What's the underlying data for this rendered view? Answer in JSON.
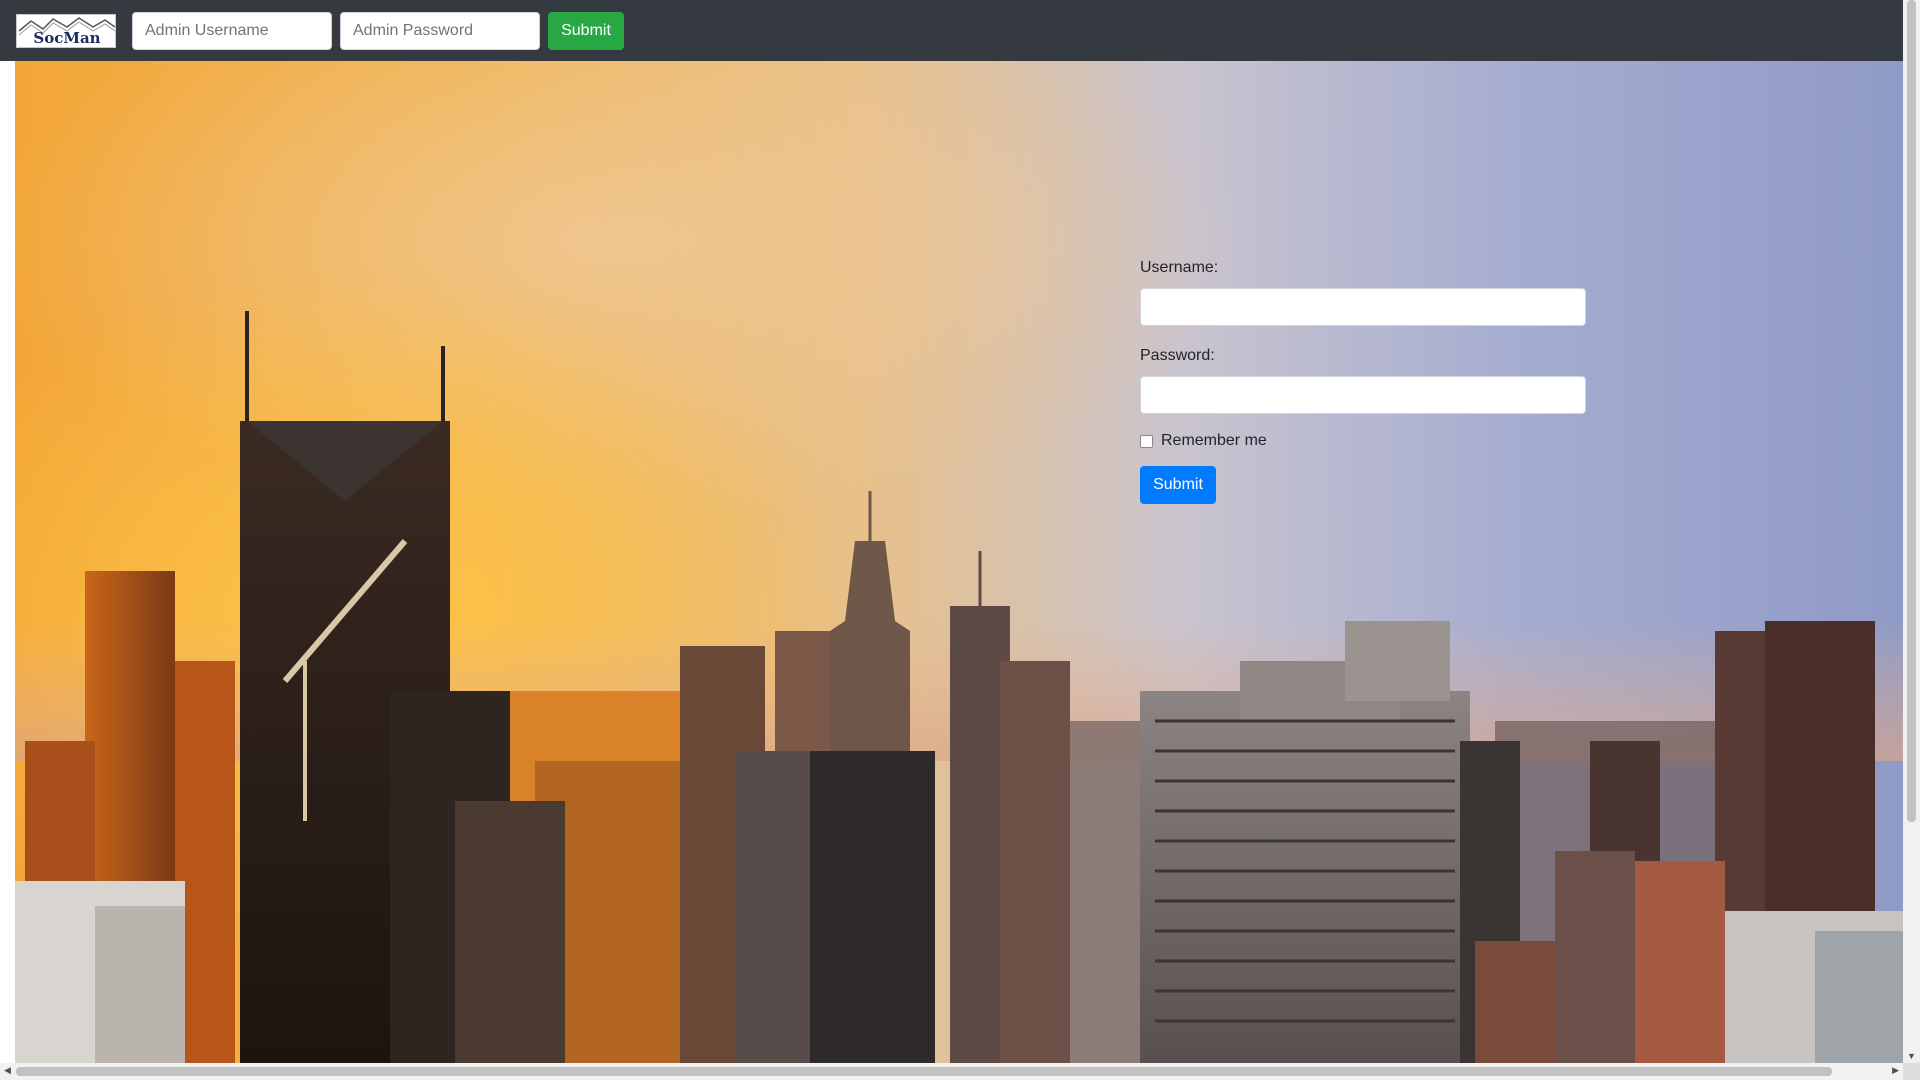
{
  "navbar": {
    "logo_text": "SocMan",
    "admin_username_placeholder": "Admin Username",
    "admin_password_placeholder": "Admin Password",
    "submit_label": "Submit"
  },
  "login_form": {
    "username_label": "Username:",
    "password_label": "Password:",
    "remember_label": "Remember me",
    "submit_label": "Submit"
  },
  "colors": {
    "navbar_bg": "#343a40",
    "nav_submit": "#28a745",
    "form_submit": "#007bff"
  },
  "icons": {
    "scroll_down": "▼",
    "scroll_left": "◀",
    "scroll_right": "▶"
  }
}
